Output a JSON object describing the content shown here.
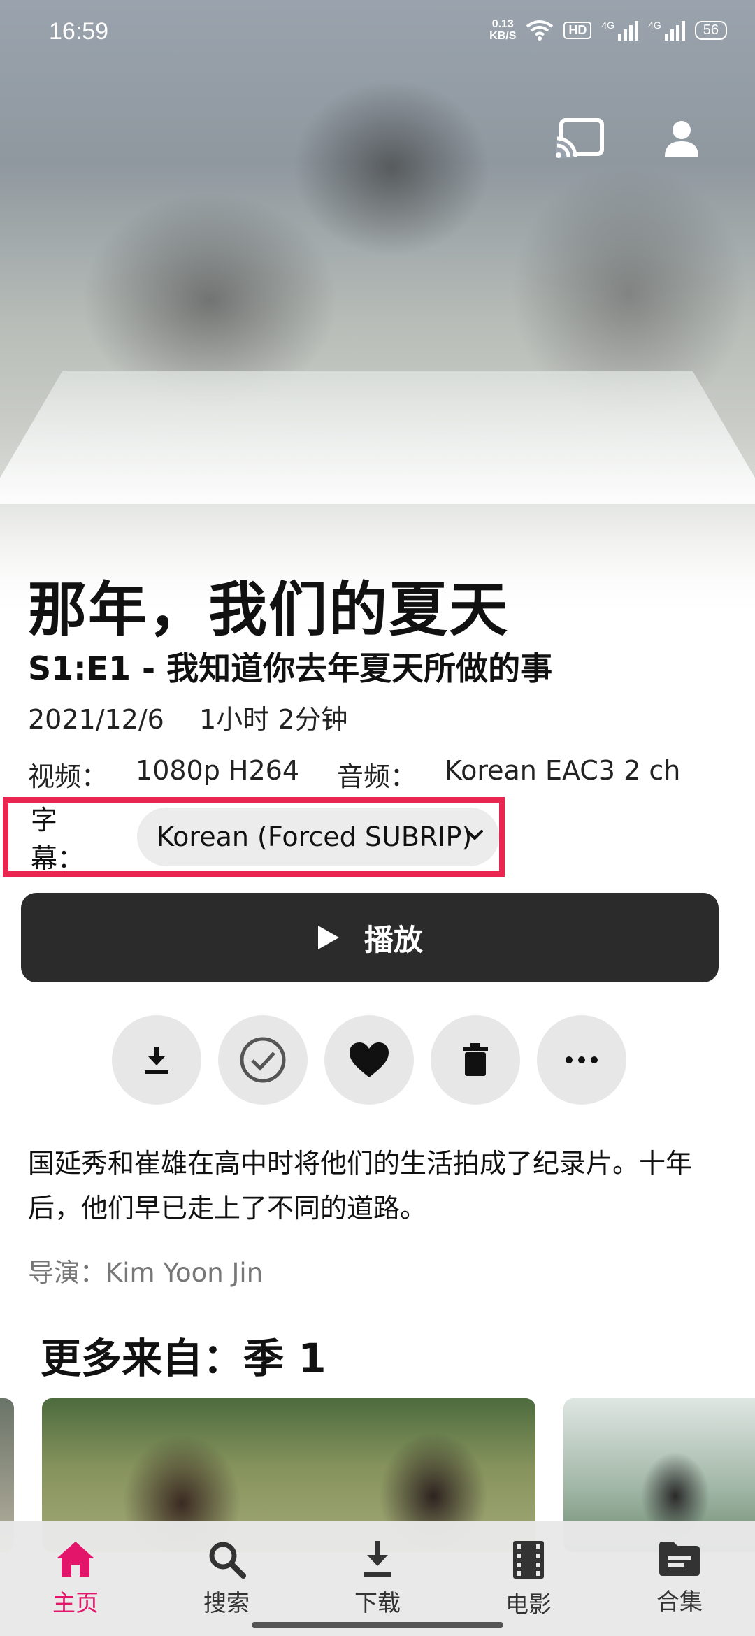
{
  "status_bar": {
    "time": "16:59",
    "net_speed_value": "0.13",
    "net_speed_unit": "KB/S",
    "hd_label": "HD",
    "signal1_label": "4G",
    "signal2_label": "4G",
    "battery": "56",
    "icons": [
      "wifi-icon",
      "signal-icon",
      "signal-icon",
      "battery-icon"
    ]
  },
  "header": {
    "cast_icon": "cast-icon",
    "user_icon": "user-icon"
  },
  "show": {
    "title": "那年，我们的夏天",
    "episode": "S1:E1 - 我知道你去年夏天所做的事",
    "date": "2021/12/6",
    "duration": "1小时 2分钟",
    "video_label": "视频：",
    "video_value": "1080p H264",
    "audio_label": "音频：",
    "audio_value": "Korean EAC3 2 ch",
    "subtitle_label": "字幕：",
    "subtitle_value": "Korean (Forced SUBRIP)"
  },
  "play_button": {
    "label": "播放"
  },
  "actions": [
    "download-icon",
    "watched-check-icon",
    "favorite-heart-icon",
    "delete-icon",
    "more-icon"
  ],
  "description": {
    "text": "国延秀和崔雄在高中时将他们的生活拍成了纪录片。十年后，他们早已走上了不同的道路。",
    "director": "导演：Kim Yoon Jin"
  },
  "more_section": {
    "title": "更多来自：季 1"
  },
  "bottom_nav": {
    "items": [
      {
        "label": "主页",
        "icon": "home-icon",
        "active": true
      },
      {
        "label": "搜索",
        "icon": "search-icon",
        "active": false
      },
      {
        "label": "下载",
        "icon": "download-icon",
        "active": false
      },
      {
        "label": "电影",
        "icon": "film-icon",
        "active": false
      },
      {
        "label": "合集",
        "icon": "folder-icon",
        "active": false
      }
    ]
  },
  "colors": {
    "accent": "#e3156b",
    "highlight_border": "#e8264f",
    "play_button_bg": "#2b2b2b"
  }
}
